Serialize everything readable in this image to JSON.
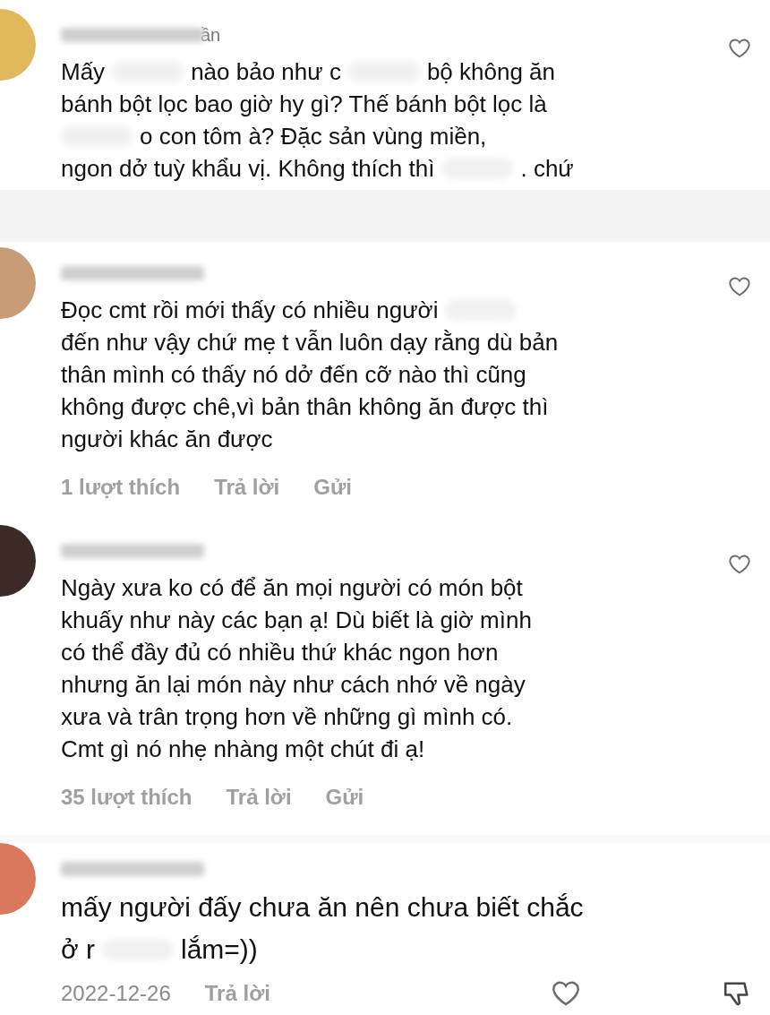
{
  "comments": [
    {
      "kind": "instagram",
      "color": "#e2b85c",
      "name_tail": "ần",
      "lines": [
        [
          {
            "kind": "text",
            "text": "Mấy"
          },
          {
            "kind": "redacted"
          },
          {
            "kind": "text",
            "text": "nào bảo như c"
          },
          {
            "kind": "redacted"
          },
          {
            "kind": "text",
            "text": "bộ không ăn"
          }
        ],
        [
          {
            "kind": "text",
            "text": "bánh bột lọc bao giờ hy gì? Thế bánh bột lọc là"
          }
        ],
        [
          {
            "kind": "redacted"
          },
          {
            "kind": "text",
            "text": "o con tôm à? Đặc sản vùng miền,"
          }
        ],
        [
          {
            "kind": "text",
            "text": "ngon dở tuỳ khẩu vị. Không thích thì"
          },
          {
            "kind": "redacted"
          },
          {
            "kind": "text",
            "text": ". chứ"
          }
        ]
      ]
    },
    {
      "kind": "instagram",
      "color": "#c99c78",
      "lines": [
        [
          {
            "kind": "text",
            "text": "Đọc cmt rồi mới thấy có nhiều người"
          },
          {
            "kind": "redacted"
          }
        ],
        [
          {
            "kind": "text",
            "text": "đến như vậy chứ mẹ t vẫn luôn dạy rằng dù bản"
          }
        ],
        [
          {
            "kind": "text",
            "text": "thân mình có thấy nó dở đến cỡ nào thì cũng"
          }
        ],
        [
          {
            "kind": "text",
            "text": "không được chê,vì bản thân không ăn được thì"
          }
        ],
        [
          {
            "kind": "text",
            "text": "người khác ăn được"
          }
        ]
      ],
      "actions": [
        "1 lượt thích",
        "Trả lời",
        "Gửi"
      ]
    },
    {
      "kind": "instagram",
      "color": "#3b2a26",
      "lines": [
        [
          {
            "kind": "text",
            "text": "Ngày xưa ko có để ăn mọi người có món bột"
          }
        ],
        [
          {
            "kind": "text",
            "text": "khuấy như này các bạn ạ! Dù biết là giờ mình"
          }
        ],
        [
          {
            "kind": "text",
            "text": "có thể đầy đủ có nhiều thứ khác ngon hơn"
          }
        ],
        [
          {
            "kind": "text",
            "text": "nhưng ăn lại món này như cách nhớ về ngày"
          }
        ],
        [
          {
            "kind": "text",
            "text": "xưa và trân trọng hơn về những gì mình có."
          }
        ],
        [
          {
            "kind": "text",
            "text": "Cmt gì nó nhẹ nhàng một chút đi ạ!"
          }
        ]
      ],
      "actions": [
        "35 lượt thích",
        "Trả lời",
        "Gửi"
      ]
    },
    {
      "kind": "tiktok",
      "color": "#d9785c",
      "lines": [
        [
          {
            "kind": "text",
            "text": "mấy người đấy chưa ăn nên chưa biết chắc"
          }
        ],
        [
          {
            "kind": "text",
            "text": "ở r"
          },
          {
            "kind": "redacted"
          },
          {
            "kind": "text",
            "text": "lắm=))"
          }
        ]
      ],
      "actions": [
        "2022-12-26",
        "Trả lời"
      ]
    }
  ]
}
